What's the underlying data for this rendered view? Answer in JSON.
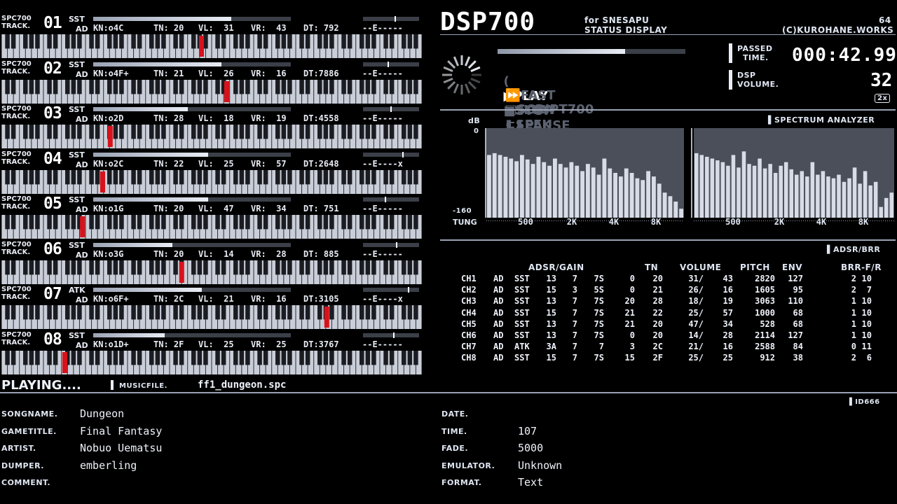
{
  "app": {
    "logo": "DSP700",
    "for_line": "for SNESAPU",
    "status_line": "STATUS DISPLAY",
    "version": "64",
    "copyright": "(C)KUROHANE.WORKS"
  },
  "channels": [
    {
      "spc": "SPC700",
      "track": "TRACK.",
      "num": "01",
      "mode": "SST",
      "ad": "AD",
      "kn": "KN:o4C",
      "tn": "TN: 20",
      "vl": "VL:  31",
      "vr": "VR:  43",
      "dt": "DT: 792",
      "env": "--E-----",
      "vol": 0.7,
      "meter": 0.58,
      "key": 0.475
    },
    {
      "spc": "SPC700",
      "track": "TRACK.",
      "num": "02",
      "mode": "SST",
      "ad": "AD",
      "kn": "KN:o4F+",
      "tn": "TN: 21",
      "vl": "VL:  26",
      "vr": "VR:  16",
      "dt": "DT:7886",
      "env": "--E-----",
      "vol": 0.65,
      "meter": 0.45,
      "key": 0.535
    },
    {
      "spc": "SPC700",
      "track": "TRACK.",
      "num": "03",
      "mode": "SST",
      "ad": "AD",
      "kn": "KN:o2D",
      "tn": "TN: 28",
      "vl": "VL:  18",
      "vr": "VR:  19",
      "dt": "DT:4558",
      "env": "--E-----",
      "vol": 0.48,
      "meter": 0.5,
      "key": 0.258
    },
    {
      "spc": "SPC700",
      "track": "TRACK.",
      "num": "04",
      "mode": "SST",
      "ad": "AD",
      "kn": "KN:o2C",
      "tn": "TN: 22",
      "vl": "VL:  25",
      "vr": "VR:  57",
      "dt": "DT:2648",
      "env": "--E----x",
      "vol": 0.58,
      "meter": 0.72,
      "key": 0.24
    },
    {
      "spc": "SPC700",
      "track": "TRACK.",
      "num": "05",
      "mode": "SST",
      "ad": "AD",
      "kn": "KN:o1G",
      "tn": "TN: 20",
      "vl": "VL:  47",
      "vr": "VR:  34",
      "dt": "DT: 751",
      "env": "--E-----",
      "vol": 0.58,
      "meter": 0.4,
      "key": 0.192
    },
    {
      "spc": "SPC700",
      "track": "TRACK.",
      "num": "06",
      "mode": "SST",
      "ad": "AD",
      "kn": "KN:o3G",
      "tn": "TN: 20",
      "vl": "VL:  14",
      "vr": "VR:  28",
      "dt": "DT: 885",
      "env": "--E-----",
      "vol": 0.4,
      "meter": 0.6,
      "key": 0.428
    },
    {
      "spc": "SPC700",
      "track": "TRACK.",
      "num": "07",
      "mode": "ATK",
      "ad": "AD",
      "kn": "KN:o6F+",
      "tn": "TN: 2C",
      "vl": "VL:  21",
      "vr": "VR:  16",
      "dt": "DT:3105",
      "env": "--E----x",
      "vol": 0.55,
      "meter": 0.82,
      "key": 0.773
    },
    {
      "spc": "SPC700",
      "track": "TRACK.",
      "num": "08",
      "mode": "SST",
      "ad": "AD",
      "kn": "KN:o1D+",
      "tn": "TN: 2F",
      "vl": "VL:  25",
      "vr": "VR:  25",
      "dt": "DT:3767",
      "env": "--E-----",
      "vol": 0.36,
      "meter": 0.55,
      "key": 0.15
    }
  ],
  "transport": {
    "play": "PLAY",
    "stop": "STOP",
    "pause": "PAUSE",
    "fast": "FAST",
    "slow": "SLOW",
    "seek": "SEEK",
    "script": "SCRIPT700",
    "progress": 0.68
  },
  "passed": {
    "label1": "PASSED",
    "label2": "TIME.",
    "value": "000:42.99"
  },
  "dsp": {
    "label1": "DSP",
    "label2": "VOLUME.",
    "value": "32",
    "mult": "2x"
  },
  "spectrum": {
    "title": "SPECTRUM ANALYZER",
    "db_label": "dB",
    "top": "0",
    "bottom": "-160",
    "tune_label": "TUNG",
    "ticks": [
      "500",
      "2K",
      "4K",
      "8K"
    ],
    "left": [
      0.7,
      0.72,
      0.7,
      0.68,
      0.66,
      0.63,
      0.7,
      0.65,
      0.6,
      0.68,
      0.62,
      0.58,
      0.66,
      0.6,
      0.56,
      0.62,
      0.58,
      0.52,
      0.6,
      0.56,
      0.48,
      0.66,
      0.55,
      0.5,
      0.46,
      0.55,
      0.5,
      0.44,
      0.42,
      0.52,
      0.46,
      0.38,
      0.28,
      0.24,
      0.18,
      0.1
    ],
    "right": [
      0.72,
      0.7,
      0.68,
      0.66,
      0.64,
      0.62,
      0.58,
      0.7,
      0.56,
      0.74,
      0.6,
      0.58,
      0.66,
      0.55,
      0.6,
      0.5,
      0.58,
      0.62,
      0.54,
      0.48,
      0.52,
      0.46,
      0.62,
      0.48,
      0.52,
      0.46,
      0.44,
      0.48,
      0.4,
      0.44,
      0.56,
      0.38,
      0.52,
      0.36,
      0.4,
      0.12,
      0.22,
      0.28
    ]
  },
  "adsr": {
    "title": "ADSR/BRR",
    "headers": {
      "adsr": "ADSR/GAIN",
      "tn": "TN",
      "volume": "VOLUME",
      "pitch": "PITCH",
      "env": "ENV",
      "brr": "BRR-F/R"
    },
    "rows": [
      [
        "CH1",
        "AD",
        "SST",
        "13",
        "7",
        "7S",
        "0",
        "20",
        "31/",
        "43",
        "2820",
        "127",
        "2",
        "10"
      ],
      [
        "CH2",
        "AD",
        "SST",
        "15",
        "3",
        "5S",
        "0",
        "21",
        "26/",
        "16",
        "1605",
        "95",
        "2",
        "7"
      ],
      [
        "CH3",
        "AD",
        "SST",
        "13",
        "7",
        "7S",
        "20",
        "28",
        "18/",
        "19",
        "3063",
        "110",
        "1",
        "10"
      ],
      [
        "CH4",
        "AD",
        "SST",
        "15",
        "7",
        "7S",
        "21",
        "22",
        "25/",
        "57",
        "1000",
        "68",
        "1",
        "10"
      ],
      [
        "CH5",
        "AD",
        "SST",
        "13",
        "7",
        "7S",
        "21",
        "20",
        "47/",
        "34",
        "528",
        "68",
        "1",
        "10"
      ],
      [
        "CH6",
        "AD",
        "SST",
        "13",
        "7",
        "7S",
        "0",
        "20",
        "14/",
        "28",
        "2114",
        "127",
        "1",
        "10"
      ],
      [
        "CH7",
        "AD",
        "ATK",
        "3A",
        "7",
        "7",
        "3",
        "2C",
        "21/",
        "16",
        "2588",
        "84",
        "0",
        "11"
      ],
      [
        "CH8",
        "AD",
        "SST",
        "15",
        "7",
        "7S",
        "15",
        "2F",
        "25/",
        "25",
        "912",
        "38",
        "2",
        "6"
      ]
    ]
  },
  "status": {
    "playing": "PLAYING....",
    "musicfile_label": "MUSICFILE.",
    "musicfile": "ff1_dungeon.spc",
    "id": "ID666"
  },
  "tags": {
    "left": [
      {
        "label": "SONGNAME.",
        "value": "Dungeon"
      },
      {
        "label": "GAMETITLE.",
        "value": "Final Fantasy"
      },
      {
        "label": "ARTIST.",
        "value": "Nobuo Uematsu"
      },
      {
        "label": "DUMPER.",
        "value": "emberling"
      },
      {
        "label": "COMMENT.",
        "value": ""
      }
    ],
    "right": [
      {
        "label": "DATE.",
        "value": ""
      },
      {
        "label": "TIME.",
        "value": "107"
      },
      {
        "label": "FADE.",
        "value": "5000"
      },
      {
        "label": "EMULATOR.",
        "value": "Unknown"
      },
      {
        "label": "FORMAT.",
        "value": "Text"
      }
    ]
  },
  "colors": {
    "key_red": "#d8121b",
    "panel": "#000000",
    "accent": "#e8ecf4",
    "bar_bg": "#3b3f48"
  }
}
